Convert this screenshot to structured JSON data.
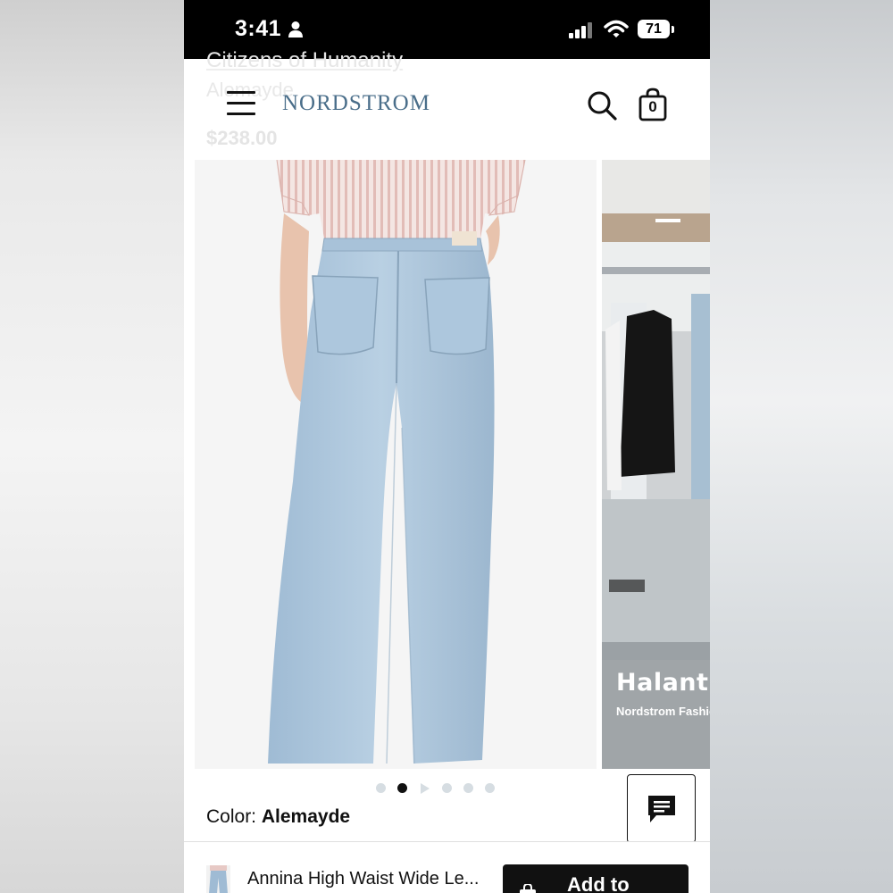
{
  "status_bar": {
    "time": "3:41",
    "battery": "71",
    "icons": [
      "person-icon",
      "signal-icon",
      "wifi-icon",
      "battery-icon"
    ]
  },
  "header": {
    "ghost_brand": "Citizens of Humanity",
    "ghost_color": "Alemayde",
    "ghost_price": "$238.00",
    "logo": "NORDSTROM",
    "bag_count": "0",
    "icons": [
      "menu-icon",
      "search-icon",
      "bag-icon"
    ]
  },
  "gallery": {
    "side_title": "Halant",
    "side_subtitle": "Nordstrom Fashio",
    "dot_count": 6,
    "active_dot": 1
  },
  "product": {
    "color_label": "Color:",
    "color_value": "Alemayde",
    "name": "Annina High Waist Wide Le..."
  },
  "actions": {
    "add_to_bag": "Add to",
    "chat_icon": "chat-icon"
  },
  "colors": {
    "logo": "#4a6e8a",
    "denim": "#a9c4dc",
    "shirt_stripe": "#e7c9c5"
  }
}
